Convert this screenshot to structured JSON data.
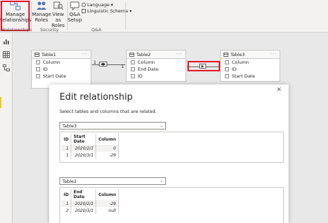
{
  "ribbon": {
    "manage_relationships": {
      "line1": "Manage",
      "line2": "Relationships"
    },
    "manage_roles": {
      "line1": "Manage",
      "line2": "Roles"
    },
    "view_as": {
      "line1": "View as",
      "line2": "Roles"
    },
    "qa_setup": {
      "line1": "Q&A",
      "line2": "Setup"
    },
    "language": "Language",
    "linguistic_schema": "Linguistic Schema",
    "groups": {
      "relationships": "Relationships",
      "security": "Security",
      "qa": "Q&A"
    }
  },
  "model": {
    "tables": [
      {
        "name": "Table1",
        "fields": [
          "Column",
          "ID",
          "Start Date"
        ]
      },
      {
        "name": "Table2",
        "fields": [
          "Column",
          "End Date",
          "ID"
        ]
      },
      {
        "name": "Table3",
        "fields": [
          "Column",
          "ID",
          "Start Date"
        ]
      }
    ],
    "rel1": {
      "left_card": "1",
      "right_card": "1"
    }
  },
  "dialog": {
    "title": "Edit relationship",
    "subtitle": "Select tables and columns that are related.",
    "close": "✕",
    "first": {
      "selected": "Table3",
      "headers": [
        "ID",
        "Start Date",
        "Column"
      ],
      "rows": [
        [
          "1",
          "2020/2/1",
          "0"
        ],
        [
          "1",
          "2020/3/1",
          "-29"
        ]
      ]
    },
    "second": {
      "selected": "Table2",
      "headers": [
        "ID",
        "End Date",
        "Column"
      ],
      "rows": [
        [
          "1",
          "2020/2/1",
          "-29"
        ],
        [
          "2",
          "2020/3/1",
          "null"
        ]
      ]
    }
  },
  "colors": {
    "highlight": "#e81123",
    "accent_nav": "#f2c811"
  }
}
